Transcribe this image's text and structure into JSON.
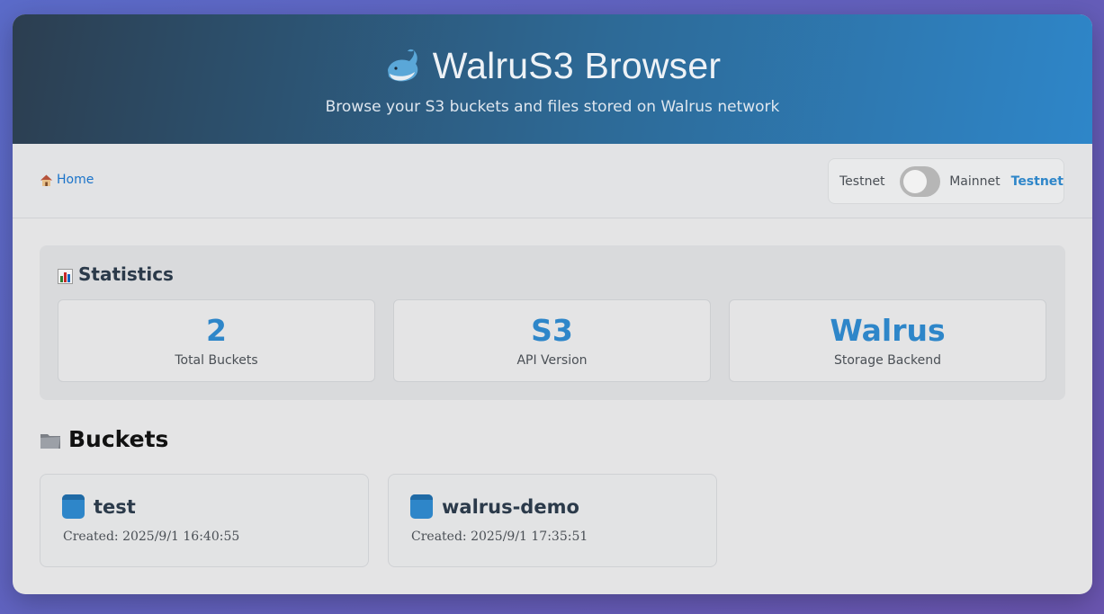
{
  "header": {
    "title": "WalruS3 Browser",
    "subtitle": "Browse your S3 buckets and files stored on Walrus network",
    "logo_icon": "whale-icon"
  },
  "nav": {
    "breadcrumb": [
      {
        "label": "Home",
        "icon": "home-icon"
      }
    ],
    "network": {
      "left_label": "Testnet",
      "right_label": "Mainnet",
      "current": "Testnet",
      "toggle_on": false
    }
  },
  "statistics": {
    "title": "Statistics",
    "icon": "chart-icon",
    "cards": [
      {
        "value": "2",
        "label": "Total Buckets"
      },
      {
        "value": "S3",
        "label": "API Version"
      },
      {
        "value": "Walrus",
        "label": "Storage Backend"
      }
    ]
  },
  "buckets": {
    "title": "Buckets",
    "icon": "folder-icon",
    "items": [
      {
        "name": "test",
        "created": "Created: 2025/9/1 16:40:55"
      },
      {
        "name": "walrus-demo",
        "created": "Created: 2025/9/1 17:35:51"
      }
    ]
  },
  "colors": {
    "accent": "#2e86c9",
    "link": "#1a73c9",
    "header_dark": "#2c3e50"
  }
}
